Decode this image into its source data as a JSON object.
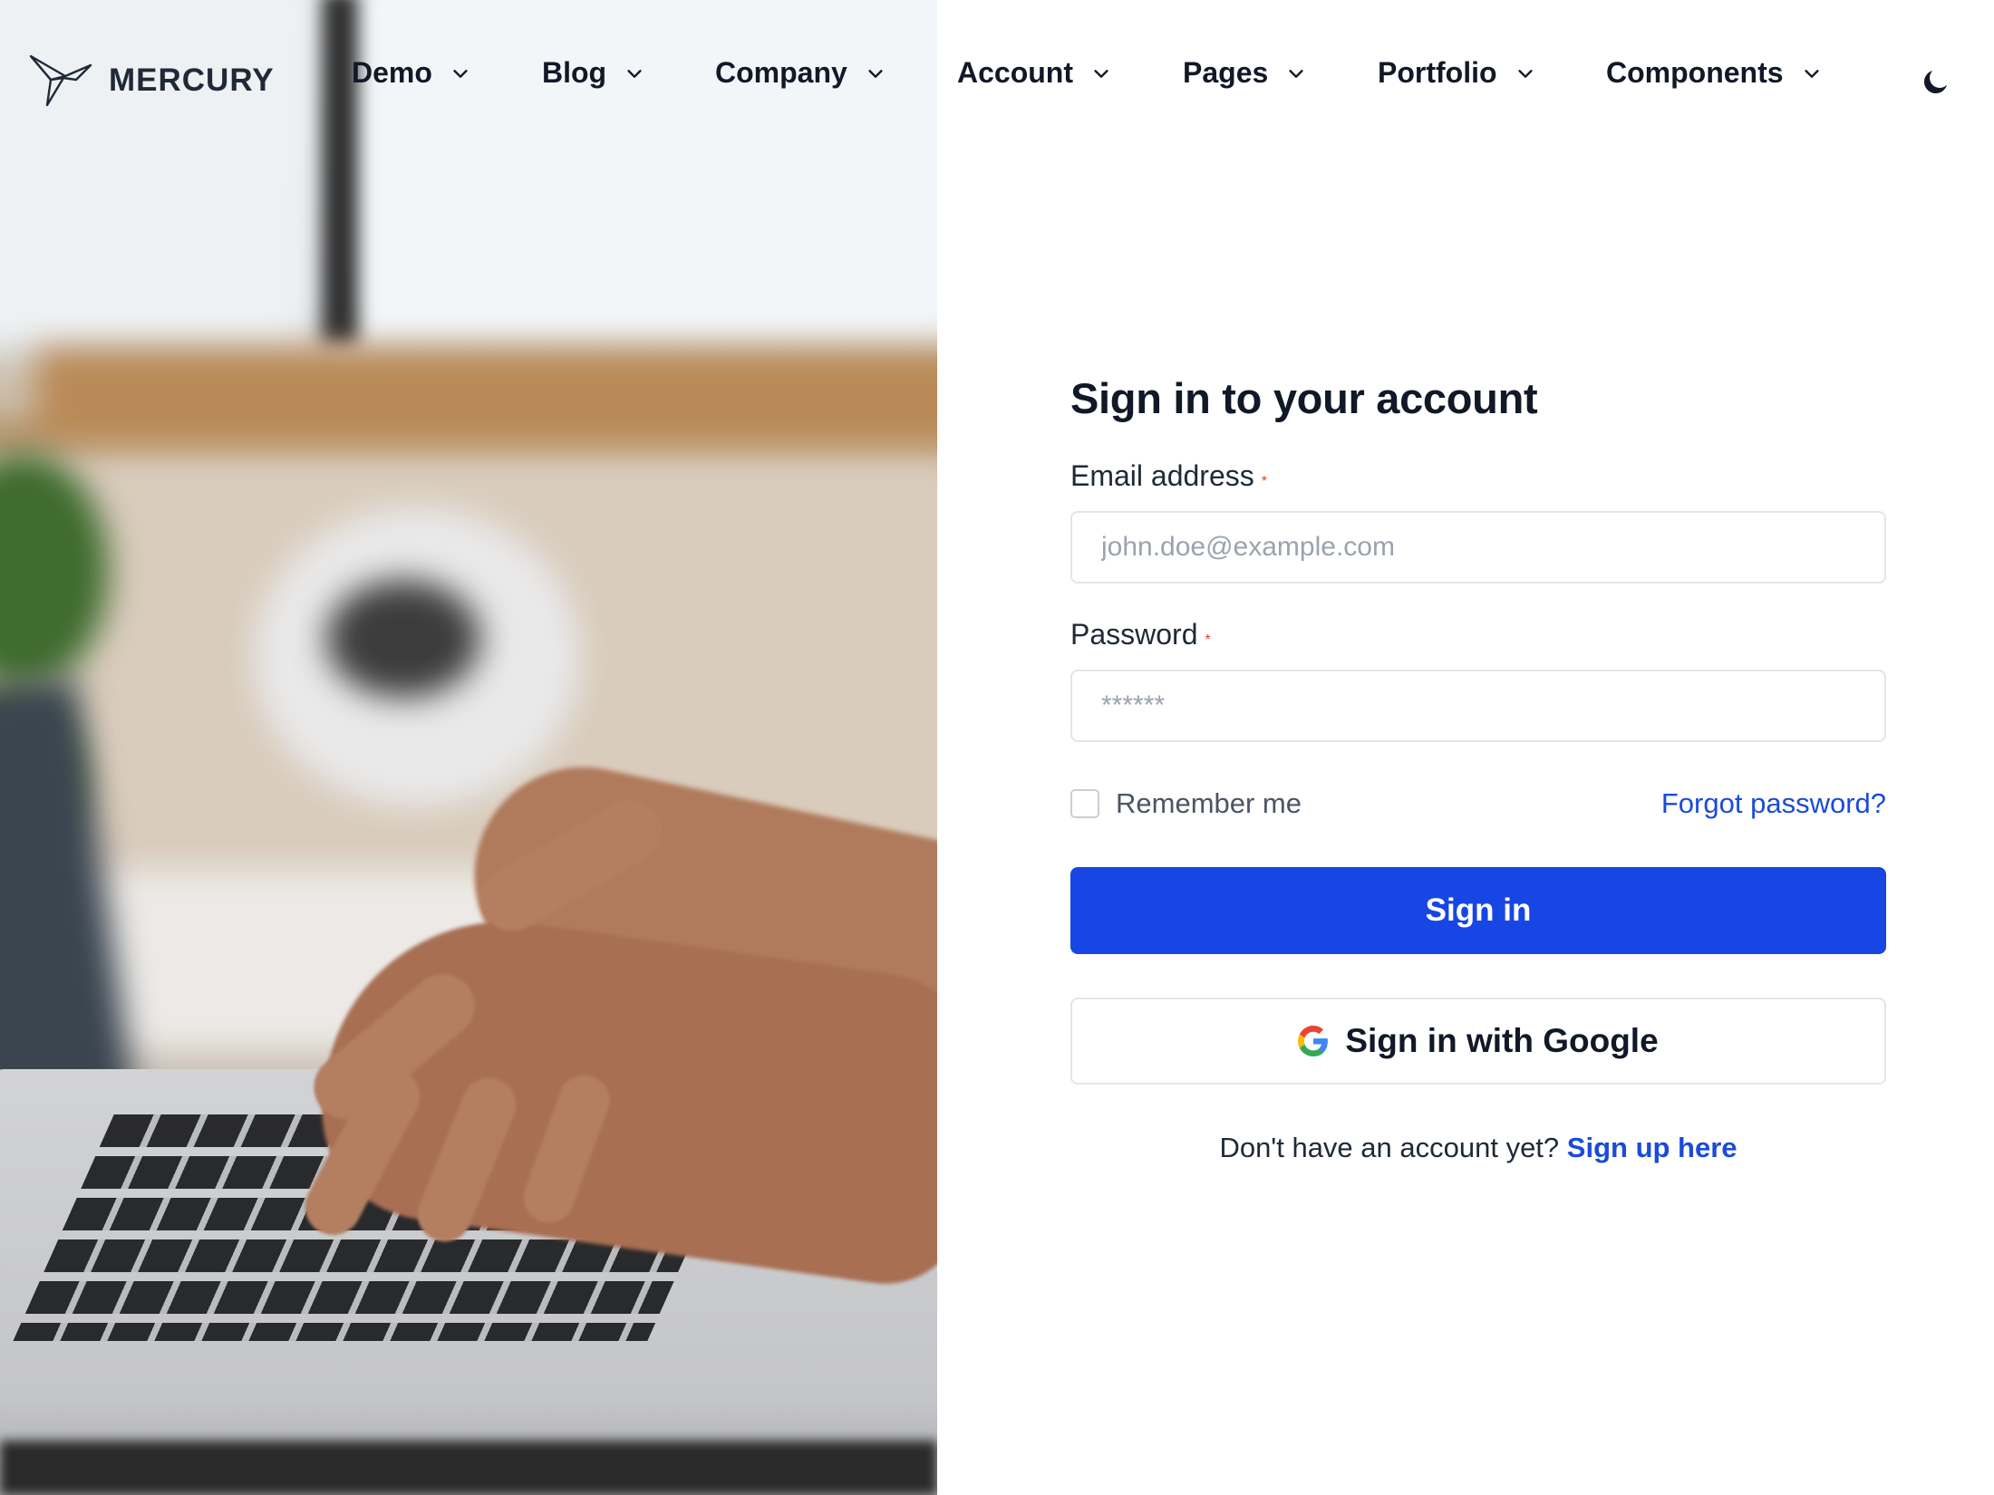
{
  "brand": {
    "name": "MERCURY",
    "logo_icon": "origami-bird-icon"
  },
  "nav": {
    "items": [
      {
        "label": "Demo"
      },
      {
        "label": "Blog"
      },
      {
        "label": "Company"
      },
      {
        "label": "Account"
      },
      {
        "label": "Pages"
      },
      {
        "label": "Portfolio"
      },
      {
        "label": "Components"
      }
    ],
    "theme_toggle_icon": "moon-icon"
  },
  "signin": {
    "title": "Sign in to your account",
    "email_label": "Email address",
    "email_placeholder": "john.doe@example.com",
    "email_value": "",
    "password_label": "Password",
    "password_placeholder": "******",
    "password_value": "",
    "required_mark": "*",
    "remember_label": "Remember me",
    "remember_checked": false,
    "forgot_label": "Forgot password?",
    "submit_label": "Sign in",
    "google_label": "Sign in with Google",
    "google_icon": "google-icon",
    "signup_prompt": "Don't have an account yet?",
    "signup_link": "Sign up here"
  },
  "colors": {
    "primary": "#1846e5",
    "link": "#1a4bd9",
    "required": "#e0412a",
    "text": "#111827",
    "border": "#e2e6ea"
  }
}
